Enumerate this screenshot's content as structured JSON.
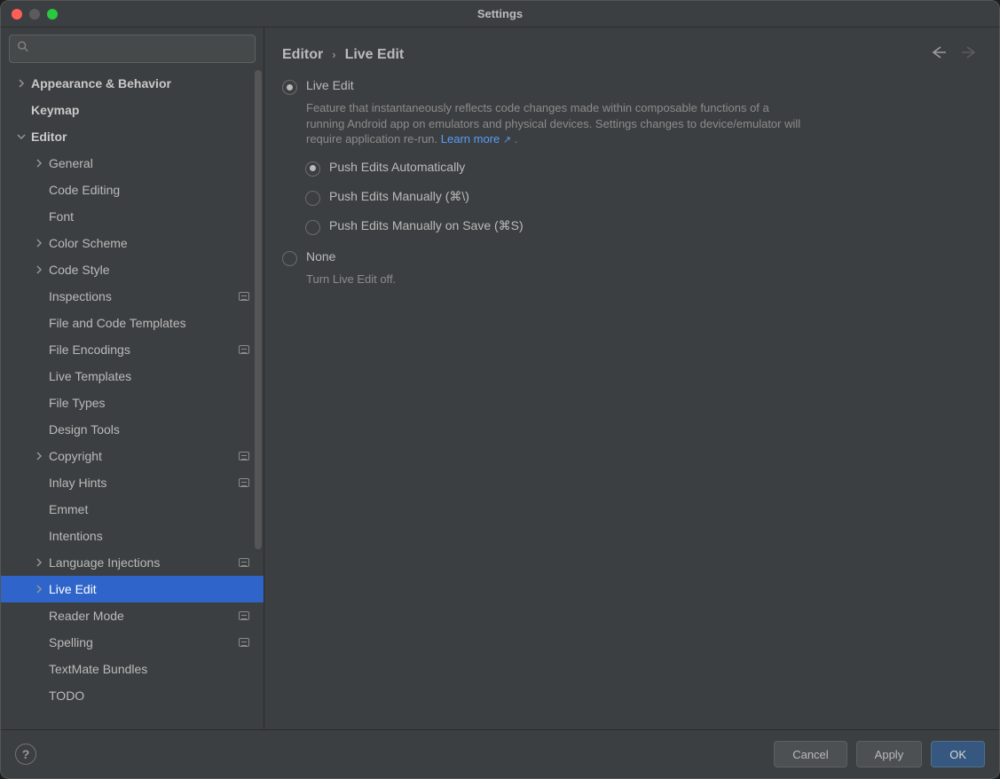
{
  "window": {
    "title": "Settings"
  },
  "search": {
    "placeholder": ""
  },
  "sidebar": {
    "items": [
      {
        "label": "Appearance & Behavior",
        "level": 0,
        "chevron": "right",
        "bold": true,
        "badge": false,
        "selected": false
      },
      {
        "label": "Keymap",
        "level": 0,
        "chevron": "none",
        "bold": true,
        "badge": false,
        "selected": false
      },
      {
        "label": "Editor",
        "level": 0,
        "chevron": "down",
        "bold": true,
        "badge": false,
        "selected": false
      },
      {
        "label": "General",
        "level": 1,
        "chevron": "right",
        "bold": false,
        "badge": false,
        "selected": false
      },
      {
        "label": "Code Editing",
        "level": 1,
        "chevron": "none",
        "bold": false,
        "badge": false,
        "selected": false
      },
      {
        "label": "Font",
        "level": 1,
        "chevron": "none",
        "bold": false,
        "badge": false,
        "selected": false
      },
      {
        "label": "Color Scheme",
        "level": 1,
        "chevron": "right",
        "bold": false,
        "badge": false,
        "selected": false
      },
      {
        "label": "Code Style",
        "level": 1,
        "chevron": "right",
        "bold": false,
        "badge": false,
        "selected": false
      },
      {
        "label": "Inspections",
        "level": 1,
        "chevron": "none",
        "bold": false,
        "badge": true,
        "selected": false
      },
      {
        "label": "File and Code Templates",
        "level": 1,
        "chevron": "none",
        "bold": false,
        "badge": false,
        "selected": false
      },
      {
        "label": "File Encodings",
        "level": 1,
        "chevron": "none",
        "bold": false,
        "badge": true,
        "selected": false
      },
      {
        "label": "Live Templates",
        "level": 1,
        "chevron": "none",
        "bold": false,
        "badge": false,
        "selected": false
      },
      {
        "label": "File Types",
        "level": 1,
        "chevron": "none",
        "bold": false,
        "badge": false,
        "selected": false
      },
      {
        "label": "Design Tools",
        "level": 1,
        "chevron": "none",
        "bold": false,
        "badge": false,
        "selected": false
      },
      {
        "label": "Copyright",
        "level": 1,
        "chevron": "right",
        "bold": false,
        "badge": true,
        "selected": false
      },
      {
        "label": "Inlay Hints",
        "level": 1,
        "chevron": "none",
        "bold": false,
        "badge": true,
        "selected": false
      },
      {
        "label": "Emmet",
        "level": 1,
        "chevron": "none",
        "bold": false,
        "badge": false,
        "selected": false
      },
      {
        "label": "Intentions",
        "level": 1,
        "chevron": "none",
        "bold": false,
        "badge": false,
        "selected": false
      },
      {
        "label": "Language Injections",
        "level": 1,
        "chevron": "right",
        "bold": false,
        "badge": true,
        "selected": false
      },
      {
        "label": "Live Edit",
        "level": 1,
        "chevron": "right",
        "bold": false,
        "badge": false,
        "selected": true
      },
      {
        "label": "Reader Mode",
        "level": 1,
        "chevron": "none",
        "bold": false,
        "badge": true,
        "selected": false
      },
      {
        "label": "Spelling",
        "level": 1,
        "chevron": "none",
        "bold": false,
        "badge": true,
        "selected": false
      },
      {
        "label": "TextMate Bundles",
        "level": 1,
        "chevron": "none",
        "bold": false,
        "badge": false,
        "selected": false
      },
      {
        "label": "TODO",
        "level": 1,
        "chevron": "none",
        "bold": false,
        "badge": false,
        "selected": false
      }
    ]
  },
  "breadcrumb": {
    "parent": "Editor",
    "current": "Live Edit"
  },
  "panel": {
    "liveEdit": {
      "label": "Live Edit",
      "checked": true,
      "desc_pre": "Feature that instantaneously reflects code changes made within composable functions of a running Android app on emulators and physical devices. Settings changes to device/emulator will require application re-run. ",
      "desc_link": "Learn more",
      "desc_post": " ."
    },
    "subOptions": [
      {
        "label": "Push Edits Automatically",
        "checked": true
      },
      {
        "label": "Push Edits Manually (⌘\\)",
        "checked": false
      },
      {
        "label": "Push Edits Manually on Save (⌘S)",
        "checked": false
      }
    ],
    "none": {
      "label": "None",
      "checked": false,
      "desc": "Turn Live Edit off."
    }
  },
  "footer": {
    "help": "?",
    "cancel": "Cancel",
    "apply": "Apply",
    "ok": "OK"
  }
}
